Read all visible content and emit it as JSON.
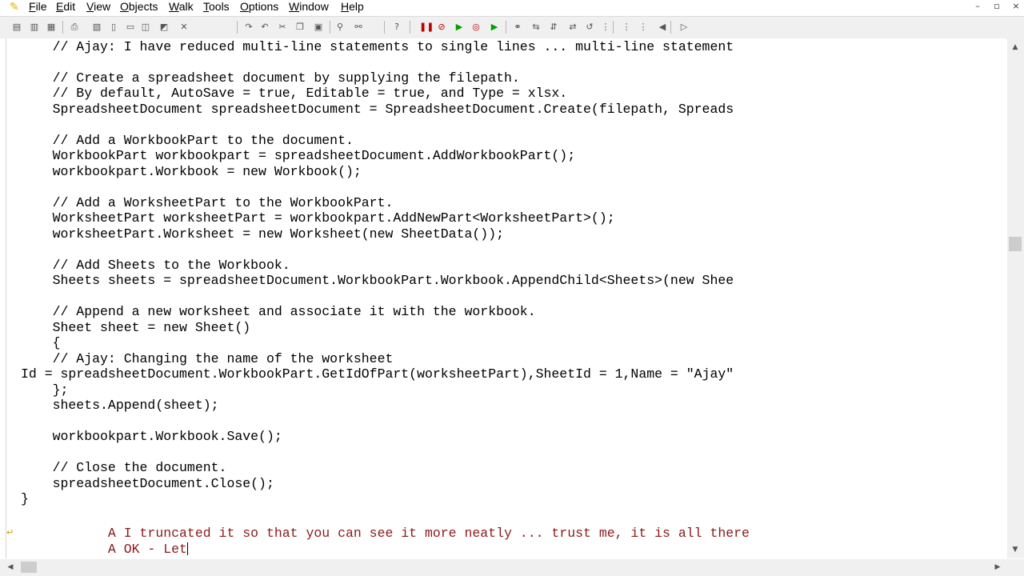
{
  "menu": {
    "items": [
      {
        "underline": "F",
        "rest": "ile"
      },
      {
        "underline": "E",
        "rest": "dit"
      },
      {
        "underline": "V",
        "rest": "iew"
      },
      {
        "underline": "O",
        "rest": "bjects"
      },
      {
        "underline": "W",
        "rest": "alk"
      },
      {
        "underline": "T",
        "rest": "ools"
      },
      {
        "underline": "O",
        "rest": "ptions"
      },
      {
        "underline": "W",
        "rest": "indow"
      },
      {
        "underline": "H",
        "rest": "elp"
      }
    ]
  },
  "window_controls": {
    "minimize": "–",
    "restore": "▫",
    "close": "×"
  },
  "toolbar_icons": [
    "open-icon",
    "save-icon",
    "save-all-icon",
    "print-icon",
    "print-preview-icon",
    "page-icon",
    "page-setup-icon",
    "copy-doc-icon",
    "paste-doc-icon",
    "delete-icon",
    "redo-icon",
    "undo-icon",
    "cut-icon",
    "copy-icon",
    "paste-icon",
    "find-icon",
    "find-next-icon",
    "help-icon",
    "pause-icon",
    "stop-icon",
    "run-icon",
    "step-icon",
    "run-to-icon",
    "walk1-icon",
    "walk2-icon",
    "walk3-icon",
    "walk4-icon",
    "walk5-icon",
    "trace1-icon",
    "trace2-icon",
    "trace3-icon",
    "back-icon",
    "forward-icon"
  ],
  "editor": {
    "lines": [
      {
        "text": "    // Ajay: I have reduced multi-line statements to single lines ... multi-line statement",
        "style": "normal"
      },
      {
        "text": "",
        "style": "normal"
      },
      {
        "text": "    // Create a spreadsheet document by supplying the filepath.",
        "style": "normal"
      },
      {
        "text": "    // By default, AutoSave = true, Editable = true, and Type = xlsx.",
        "style": "normal"
      },
      {
        "text": "    SpreadsheetDocument spreadsheetDocument = SpreadsheetDocument.Create(filepath, Spreads",
        "style": "normal"
      },
      {
        "text": "",
        "style": "normal"
      },
      {
        "text": "    // Add a WorkbookPart to the document.",
        "style": "normal"
      },
      {
        "text": "    WorkbookPart workbookpart = spreadsheetDocument.AddWorkbookPart();",
        "style": "normal"
      },
      {
        "text": "    workbookpart.Workbook = new Workbook();",
        "style": "normal"
      },
      {
        "text": "",
        "style": "normal"
      },
      {
        "text": "    // Add a WorksheetPart to the WorkbookPart.",
        "style": "normal"
      },
      {
        "text": "    WorksheetPart worksheetPart = workbookpart.AddNewPart<WorksheetPart>();",
        "style": "normal"
      },
      {
        "text": "    worksheetPart.Worksheet = new Worksheet(new SheetData());",
        "style": "normal"
      },
      {
        "text": "",
        "style": "normal"
      },
      {
        "text": "    // Add Sheets to the Workbook.",
        "style": "normal"
      },
      {
        "text": "    Sheets sheets = spreadsheetDocument.WorkbookPart.Workbook.AppendChild<Sheets>(new Shee",
        "style": "normal"
      },
      {
        "text": "",
        "style": "normal"
      },
      {
        "text": "    // Append a new worksheet and associate it with the workbook.",
        "style": "normal"
      },
      {
        "text": "    Sheet sheet = new Sheet()",
        "style": "normal"
      },
      {
        "text": "    {",
        "style": "normal"
      },
      {
        "text": "    // Ajay: Changing the name of the worksheet",
        "style": "normal"
      },
      {
        "text": "Id = spreadsheetDocument.WorkbookPart.GetIdOfPart(worksheetPart),SheetId = 1,Name = \"Ajay\"",
        "style": "normal"
      },
      {
        "text": "    };",
        "style": "normal"
      },
      {
        "text": "    sheets.Append(sheet);",
        "style": "normal"
      },
      {
        "text": "",
        "style": "normal"
      },
      {
        "text": "    workbookpart.Workbook.Save();",
        "style": "normal"
      },
      {
        "text": "",
        "style": "normal"
      },
      {
        "text": "    // Close the document.",
        "style": "normal"
      },
      {
        "text": "    spreadsheetDocument.Close();",
        "style": "normal"
      },
      {
        "text": "}",
        "style": "normal"
      },
      {
        "text": "",
        "style": "normal"
      },
      {
        "text": "           A I truncated it so that you can see it more neatly ... trust me, it is all there",
        "style": "red"
      },
      {
        "text": "           A OK - Let",
        "style": "red"
      }
    ]
  }
}
